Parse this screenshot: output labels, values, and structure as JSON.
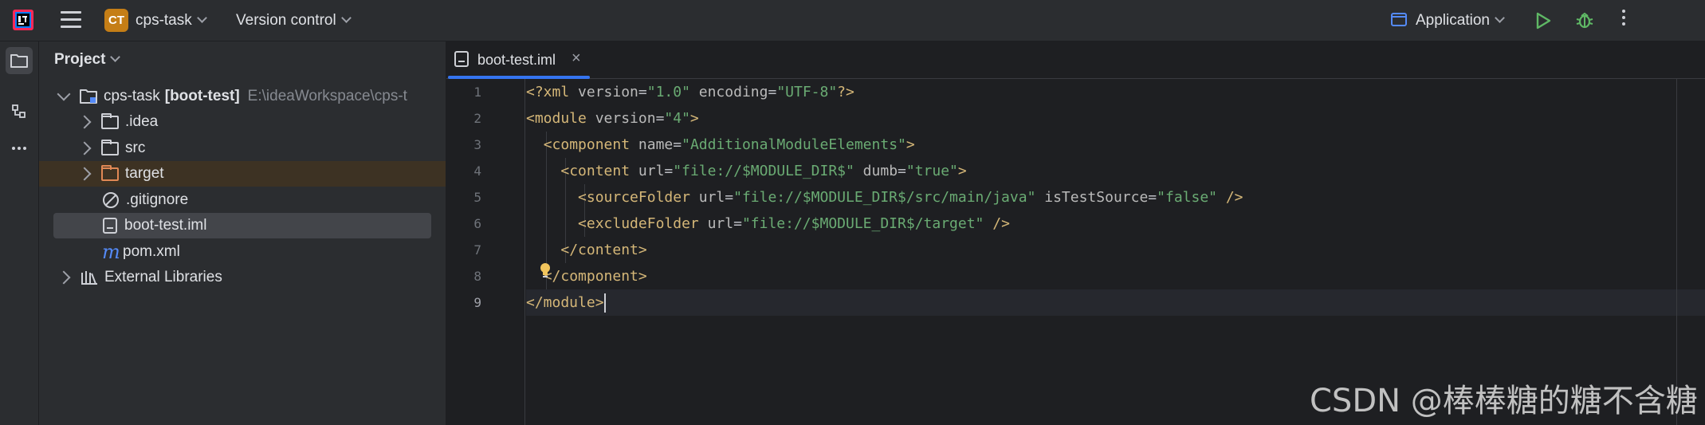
{
  "titlebar": {
    "project_badge": "CT",
    "project_name": "cps-task",
    "vcs_label": "Version control",
    "run_config": "Application"
  },
  "panel": {
    "title": "Project",
    "tree": [
      {
        "label": "cps-task",
        "label_bold": "[boot-test]",
        "path": "E:\\ideaWorkspace\\cps-t",
        "level": 0,
        "expanded": true,
        "icon": "module-icon"
      },
      {
        "label": ".idea",
        "level": 1,
        "icon": "folder-icon"
      },
      {
        "label": "src",
        "level": 1,
        "icon": "folder-icon"
      },
      {
        "label": "target",
        "level": 1,
        "icon": "folder-excluded-icon"
      },
      {
        "label": ".gitignore",
        "level": 1,
        "icon": "ignore-file-icon"
      },
      {
        "label": "boot-test.iml",
        "level": 1,
        "icon": "iml-file-icon",
        "selected": true
      },
      {
        "label": "pom.xml",
        "level": 1,
        "icon": "maven-icon"
      },
      {
        "label": "External Libraries",
        "level": 0,
        "icon": "libraries-icon"
      }
    ]
  },
  "editor": {
    "tab_label": "boot-test.iml",
    "line_numbers": [
      "1",
      "2",
      "3",
      "4",
      "5",
      "6",
      "7",
      "8",
      "9"
    ],
    "current_line": 9
  },
  "colors": {
    "accent": "#3574f0",
    "tag": "#d5b778",
    "string": "#6aab73",
    "attribute": "#bababa",
    "badge": "#c57e16"
  },
  "watermark": "CSDN @棒棒糖的糖不含糖"
}
